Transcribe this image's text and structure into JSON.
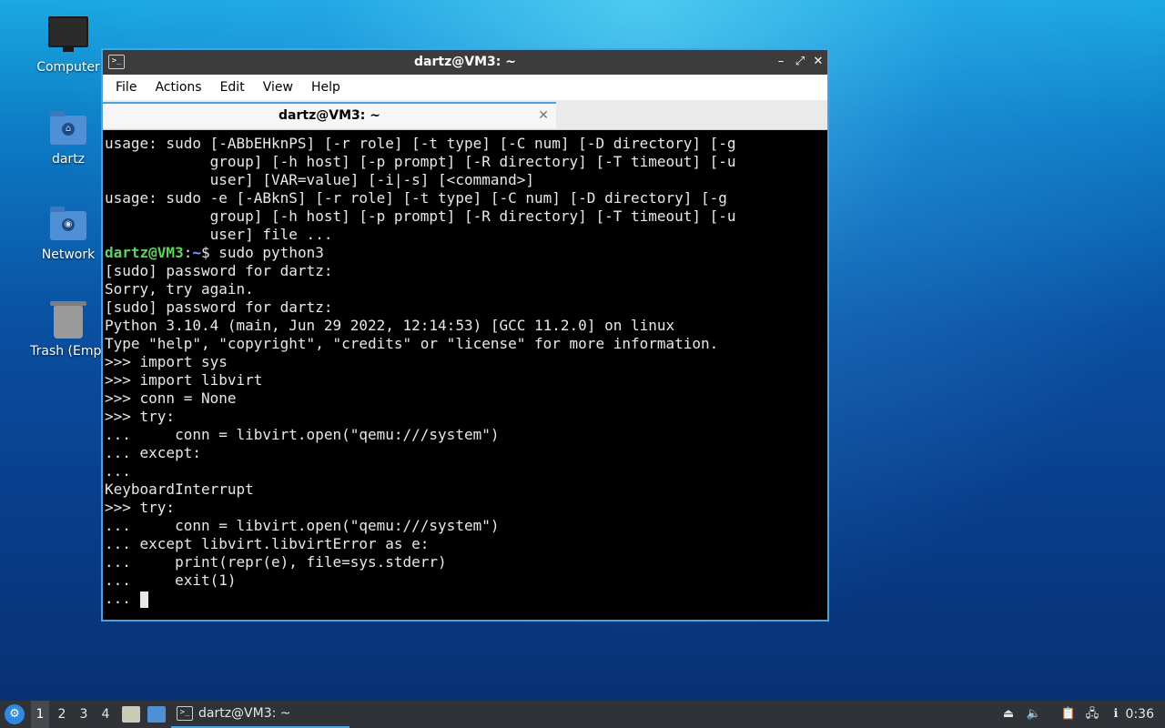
{
  "desktop": {
    "icons": [
      {
        "label": "Computer"
      },
      {
        "label": "dartz"
      },
      {
        "label": "Network"
      },
      {
        "label": "Trash (Empt"
      }
    ]
  },
  "window": {
    "title": "dartz@VM3: ~",
    "buttons": {
      "minimize": "–",
      "maximize": "⤢",
      "close": "✕"
    },
    "menu": [
      "File",
      "Actions",
      "Edit",
      "View",
      "Help"
    ],
    "tab": {
      "label": "dartz@VM3: ~",
      "close": "✕"
    },
    "prompt": {
      "user_host": "dartz@VM3",
      "sep": ":",
      "path": "~",
      "suffix": "$ sudo python3"
    },
    "terminal_lines_before": [
      "usage: sudo [-ABbEHknPS] [-r role] [-t type] [-C num] [-D directory] [-g",
      "            group] [-h host] [-p prompt] [-R directory] [-T timeout] [-u",
      "            user] [VAR=value] [-i|-s] [<command>]",
      "usage: sudo -e [-ABknS] [-r role] [-t type] [-C num] [-D directory] [-g",
      "            group] [-h host] [-p prompt] [-R directory] [-T timeout] [-u",
      "            user] file ..."
    ],
    "terminal_lines_after": [
      "[sudo] password for dartz:",
      "Sorry, try again.",
      "[sudo] password for dartz:",
      "Python 3.10.4 (main, Jun 29 2022, 12:14:53) [GCC 11.2.0] on linux",
      "Type \"help\", \"copyright\", \"credits\" or \"license\" for more information.",
      ">>> import sys",
      ">>> import libvirt",
      ">>> conn = None",
      ">>> try:",
      "...     conn = libvirt.open(\"qemu:///system\")",
      "... except:",
      "...",
      "KeyboardInterrupt",
      ">>> try:",
      "...     conn = libvirt.open(\"qemu:///system\")",
      "... except libvirt.libvirtError as e:",
      "...     print(repr(e), file=sys.stderr)",
      "...     exit(1)"
    ],
    "last_prompt": "... "
  },
  "taskbar": {
    "workspaces": [
      "1",
      "2",
      "3",
      "4"
    ],
    "active_workspace": "1",
    "task_label": "dartz@VM3: ~",
    "clock": "0:36"
  }
}
